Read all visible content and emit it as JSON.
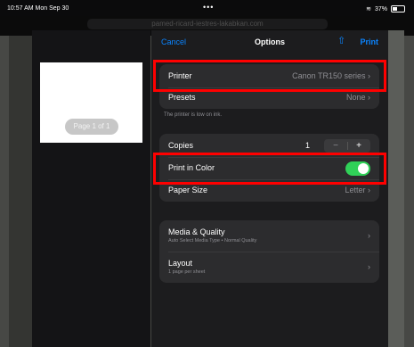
{
  "status": {
    "time": "10:57 AM  Mon Sep 30",
    "dots": "•••",
    "wifi": "wifi",
    "battery": "37%"
  },
  "browser": {
    "url": "pamed-ricard-iestres-lakabkan.com"
  },
  "preview": {
    "page_label": "Page 1 of 1"
  },
  "nav": {
    "cancel": "Cancel",
    "title": "Options",
    "print": "Print",
    "share_icon": "share-icon"
  },
  "printer_group": {
    "printer_label": "Printer",
    "printer_value": "Canon TR150 series",
    "presets_label": "Presets",
    "presets_value": "None",
    "note": "The printer is low on ink."
  },
  "copies_group": {
    "copies_label": "Copies",
    "copies_value": "1",
    "minus": "−",
    "plus": "+",
    "color_label": "Print in Color",
    "color_on": true,
    "paper_label": "Paper Size",
    "paper_value": "Letter"
  },
  "media_group": {
    "media_label": "Media & Quality",
    "media_sub": "Auto Select Media Type • Normal Quality",
    "layout_label": "Layout",
    "layout_sub": "1 page per sheet"
  },
  "chevron": "›",
  "colors": {
    "accent": "#0a84ff",
    "toggle": "#30d158",
    "highlight": "#ff0000"
  }
}
